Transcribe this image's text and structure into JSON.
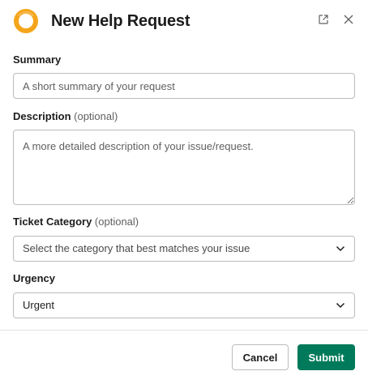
{
  "header": {
    "title": "New Help Request",
    "logo_icon": "orange-ring-logo-icon",
    "popout_icon": "external-link-icon",
    "close_icon": "close-icon"
  },
  "form": {
    "summary": {
      "label": "Summary",
      "placeholder": "A short summary of your request",
      "value": ""
    },
    "description": {
      "label": "Description",
      "optional": "(optional)",
      "placeholder": "A more detailed description of your issue/request.",
      "value": ""
    },
    "ticket_category": {
      "label": "Ticket Category",
      "optional": "(optional)",
      "placeholder": "Select the category that best matches your issue",
      "icon": "chevron-down-icon"
    },
    "urgency": {
      "label": "Urgency",
      "selected": "Urgent",
      "icon": "chevron-down-icon"
    }
  },
  "footer": {
    "cancel_label": "Cancel",
    "submit_label": "Submit"
  },
  "colors": {
    "brand_orange": "#f5a51b",
    "submit_green": "#007a5a",
    "text_primary": "#1d1c1d",
    "text_muted": "#616061",
    "border": "#bcbcbc"
  }
}
